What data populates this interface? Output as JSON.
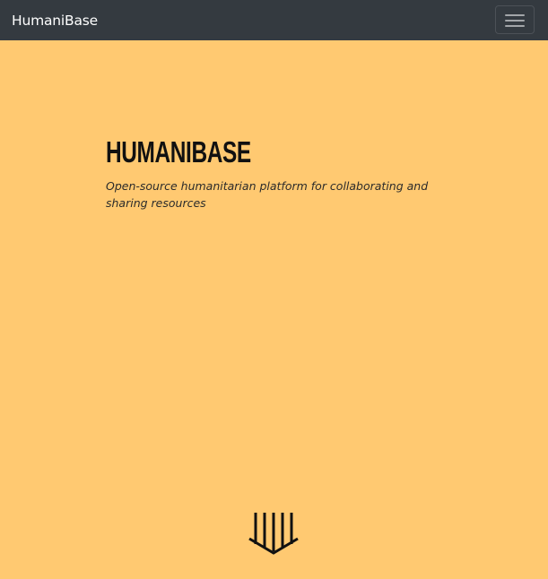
{
  "navbar": {
    "brand": "HumaniBase",
    "toggler_icon": "hamburger-menu-icon"
  },
  "hero": {
    "title": "HUMANIBASE",
    "subtitle": "Open-source humanitarian platform for collaborating and sharing resources"
  },
  "scroll_icon": "scroll-down-arrow-icon",
  "colors": {
    "navbar_bg": "#343a40",
    "page_bg": "#ffc971",
    "text_dark": "#111111"
  }
}
